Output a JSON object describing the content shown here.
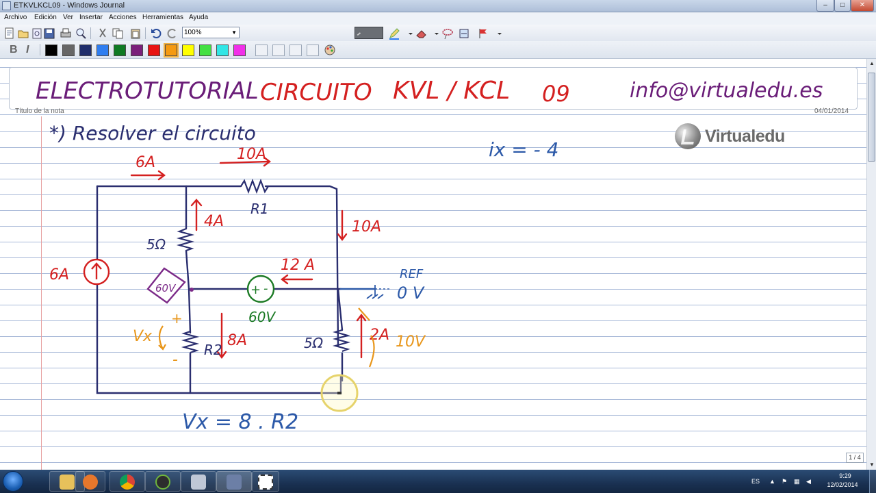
{
  "window": {
    "title": "ETKVLKCL09 - Windows Journal"
  },
  "menu": [
    "Archivo",
    "Edición",
    "Ver",
    "Insertar",
    "Acciones",
    "Herramientas",
    "Ayuda"
  ],
  "toolbar": {
    "zoom": "100%"
  },
  "colors": {
    "palette": [
      "#000000",
      "#666666",
      "#1f2d6b",
      "#2f7ef0",
      "#0f7a23",
      "#7a1f7a",
      "#e81414",
      "#f59a12",
      "#ffff00",
      "#43e043",
      "#31e6e6",
      "#f12fe9"
    ],
    "red_ink": "#d42020",
    "blue_ink": "#2c59a8",
    "navy_ink": "#2a2e6f",
    "green_ink": "#1b7a24",
    "purple_ink": "#7b2a88",
    "orange_ink": "#e8961a",
    "purple_title": "#6a1d78"
  },
  "note": {
    "title": "ELECTROTUTORIAL   CIRCUITO   KVL / KCL   09",
    "title_parts": {
      "main": "ELECTROTUTORIAL",
      "circuit": "CIRCUITO",
      "topic": "KVL / KCL",
      "number": "09",
      "email": "info@virtualedu.es"
    },
    "caption": "Título de la nota",
    "date": "04/01/2014",
    "instruction": "*) Resolver el circuito",
    "ix_formula": "ix = - 4",
    "vx_formula": "Vx = 8 . R2",
    "logo": "Virtualedu",
    "page_counter": "1 / 4"
  },
  "circuit": {
    "currents": {
      "top_left": "6A",
      "top_right": "10A",
      "branch_5ohm_top": "4A",
      "right_branch": "10A",
      "middle": "12 A",
      "r2": "8A",
      "bottom_right": "2A",
      "source_left": "6A"
    },
    "labels": {
      "r1": "R1",
      "r2": "R2",
      "res_5ohm_top": "5Ω",
      "res_5ohm_bottom": "5Ω",
      "dep_source": "60V",
      "volt_source": "60V",
      "ref": "REF",
      "ref_volt": "0 V",
      "vx": "Vx",
      "plus": "+",
      "minus": "-",
      "voltage_10v": "10V"
    }
  },
  "taskbar": {
    "lang": "ES",
    "time": "9:29",
    "date": "12/02/2014"
  }
}
